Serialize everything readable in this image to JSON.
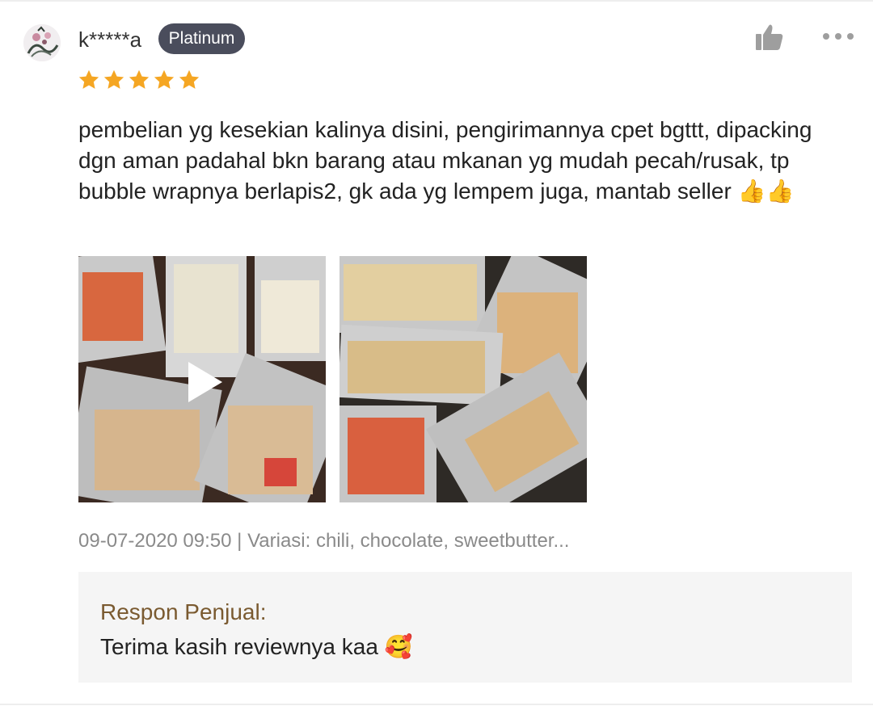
{
  "review": {
    "username": "k*****a",
    "badge": "Platinum",
    "rating": 5,
    "text": "pembelian yg kesekian kalinya disini, pengirimannya cpet bgttt, dipacking dgn aman padahal bkn barang atau mkanan yg mudah pecah/rusak, tp bubble wrapnya berlapis2, gk ada yg lempem juga, mantab seller 👍👍",
    "meta": "09-07-2020 09:50 | Variasi: chili, chocolate, sweetbutter...",
    "media": [
      {
        "type": "video",
        "icon": "play-icon"
      },
      {
        "type": "photo",
        "icon": "photo"
      }
    ]
  },
  "seller_response": {
    "title": "Respon Penjual:",
    "text": "Terima kasih reviewnya kaa 🥰"
  },
  "icons": {
    "like": "thumbs-up-icon",
    "more": "more-options-icon",
    "star": "star-icon"
  },
  "colors": {
    "badge_bg": "#4a4d5c",
    "star": "#f5a623",
    "response_title": "#7a5a30",
    "response_bg": "#f5f5f5",
    "meta_text": "#8a8a8a"
  }
}
